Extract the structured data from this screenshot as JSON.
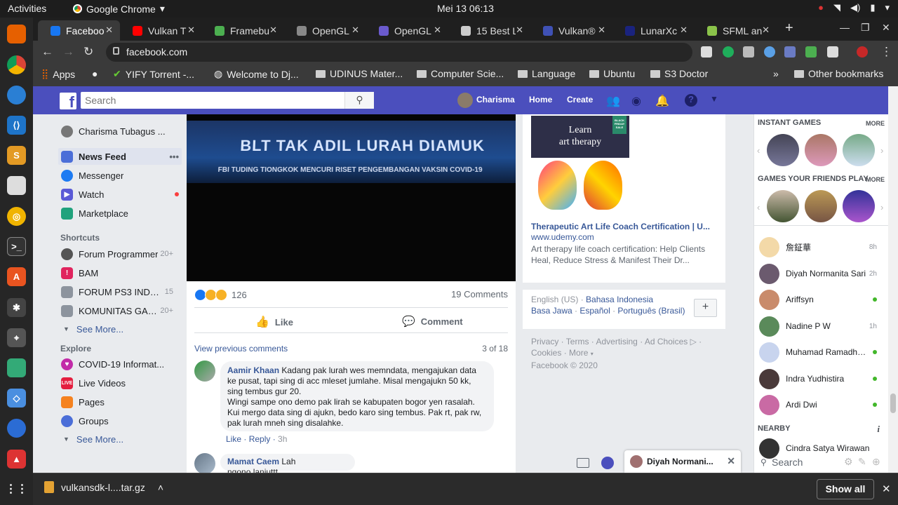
{
  "system": {
    "activities": "Activities",
    "app_name": "Google Chrome",
    "clock": "Mei 13  06:13"
  },
  "browser": {
    "tabs": [
      {
        "label": "Faceboo",
        "color": "#1877f2"
      },
      {
        "label": "Vulkan T",
        "color": "#ff0000"
      },
      {
        "label": "Framebu",
        "color": "#4caf50"
      },
      {
        "label": "OpenGL",
        "color": "#888888"
      },
      {
        "label": "OpenGL",
        "color": "#6a5acd"
      },
      {
        "label": "15 Best L",
        "color": "#cccccc"
      },
      {
        "label": "Vulkan®",
        "color": "#3f51b5"
      },
      {
        "label": "LunarXc",
        "color": "#1a237e"
      },
      {
        "label": "SFML an",
        "color": "#8bc34a"
      }
    ],
    "url": "facebook.com",
    "bookmarks": [
      {
        "label": "Apps"
      },
      {
        "label": ""
      },
      {
        "label": "YIFY Torrent -..."
      },
      {
        "label": "Welcome to Dj..."
      },
      {
        "label": "UDINUS Mater..."
      },
      {
        "label": "Computer Scie..."
      },
      {
        "label": "Language"
      },
      {
        "label": "Ubuntu"
      },
      {
        "label": "S3 Doctor"
      }
    ],
    "other_bookmarks": "Other bookmarks"
  },
  "header": {
    "search_placeholder": "Search",
    "user": "Charisma",
    "home": "Home",
    "create": "Create"
  },
  "leftnav": {
    "profile": "Charisma Tubagus ...",
    "items": [
      {
        "label": "News Feed",
        "color": "#4b6ed8"
      },
      {
        "label": "Messenger",
        "color": "#1d7bf2"
      },
      {
        "label": "Watch",
        "color": "#5a5ad6"
      },
      {
        "label": "Marketplace",
        "color": "#20a27c"
      }
    ],
    "shortcuts_title": "Shortcuts",
    "shortcuts": [
      {
        "label": "Forum Programmer",
        "count": "20+"
      },
      {
        "label": "BAM",
        "count": ""
      },
      {
        "label": "FORUM PS3 INDO...",
        "count": "15"
      },
      {
        "label": "KOMUNITAS GAM...",
        "count": "20+"
      }
    ],
    "see_more": "See More...",
    "explore_title": "Explore",
    "explore": [
      {
        "label": "COVID-19 Informat...",
        "color": "#c22ba8"
      },
      {
        "label": "Live Videos",
        "color": "#e41e3f"
      },
      {
        "label": "Pages",
        "color": "#f5821f"
      },
      {
        "label": "Groups",
        "color": "#4b6ed8"
      }
    ],
    "see_more_2": "See More..."
  },
  "post": {
    "video_banner": "BLT TAK ADIL LURAH DIAMUK",
    "video_ticker": "FBI TUDING TIONGKOK MENCURI RISET PENGEMBANGAN VAKSIN COVID-19",
    "reaction_count": "126",
    "comment_count": "19 Comments",
    "like": "Like",
    "comment": "Comment",
    "view_previous": "View previous comments",
    "pager": "3 of 18",
    "comments": [
      {
        "author": "Aamir Khaan",
        "text": "Kadang pak lurah wes memndata, mengajukan data ke pusat, tapi sing di acc mleset jumlahe. Misal mengajukn 50 kk, sing tembus gur 20.",
        "text2": "Wingi sampe ono demo pak lirah se kabupaten bogor yen rasalah. Kui mergo data sing di ajukn, bedo karo sing tembus. Pak rt, pak rw, pak lurah mneh sing disalahke.",
        "like": "Like",
        "reply": "Reply",
        "time": "3h"
      },
      {
        "author": "Mamat Caem",
        "text": "Lah ngono.lanjuttt"
      }
    ]
  },
  "ad": {
    "image_text_1": "Learn",
    "image_text_2": "art therapy",
    "sale_tag": "BLACK FRIDAY SALE",
    "title": "Therapeutic Art Life Coach Certification | U...",
    "domain": "www.udemy.com",
    "desc": "Art therapy life coach certification: Help Clients Heal, Reduce Stress & Manifest Their Dr..."
  },
  "languages": {
    "current": "English (US)",
    "options": [
      "Bahasa Indonesia",
      "Basa Jawa",
      "Español",
      "Português (Brasil)"
    ],
    "add": "+"
  },
  "footer": {
    "links": [
      "Privacy",
      "Terms",
      "Advertising",
      "Ad Choices",
      "Cookies",
      "More"
    ],
    "copyright": "Facebook © 2020"
  },
  "rightbar": {
    "instant_games": "INSTANT GAMES",
    "friends_games": "GAMES YOUR FRIENDS PLAY",
    "more": "MORE",
    "contacts": [
      {
        "name": "詹鉦華",
        "status": "8h",
        "online": false
      },
      {
        "name": "Diyah Normanita Sari",
        "status": "2h",
        "online": false
      },
      {
        "name": "Ariffsyn",
        "status": "",
        "online": true
      },
      {
        "name": "Nadine P W",
        "status": "1h",
        "online": false
      },
      {
        "name": "Muhamad Ramadhan...",
        "status": "",
        "online": true
      },
      {
        "name": "Indra Yudhistira",
        "status": "",
        "online": true
      },
      {
        "name": "Ardi Dwi",
        "status": "",
        "online": true
      }
    ],
    "nearby": "NEARBY",
    "nearby_contact": "Cindra Satya Wirawan",
    "search": "Search"
  },
  "chat": {
    "open_tab": "Diyah Normani..."
  },
  "downloads": {
    "file": "vulkansdk-l....tar.gz",
    "show_all": "Show all"
  }
}
